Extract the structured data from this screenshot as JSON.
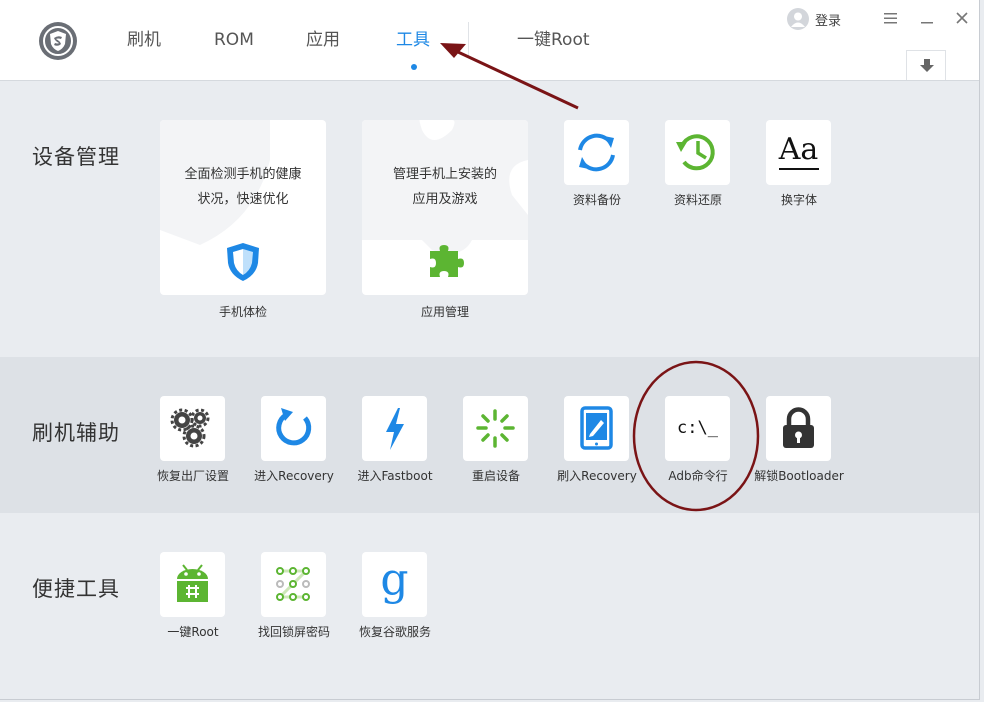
{
  "header": {
    "tabs": [
      {
        "label": "刷机"
      },
      {
        "label": "ROM"
      },
      {
        "label": "应用"
      },
      {
        "label": "工具"
      },
      {
        "label": "一键Root"
      }
    ],
    "active_tab": "工具",
    "login_label": "登录",
    "accent_color": "#1e88e5"
  },
  "device_management": {
    "title": "设备管理",
    "cards": [
      {
        "description_line1": "全面检测手机的健康",
        "description_line2": "状况，快速优化",
        "label": "手机体检",
        "icon": "shield-icon"
      },
      {
        "description_line1": "管理手机上安装的",
        "description_line2": "应用及游戏",
        "label": "应用管理",
        "icon": "puzzle-icon"
      }
    ],
    "tiles": [
      {
        "label": "资料备份",
        "icon": "sync-icon"
      },
      {
        "label": "资料还原",
        "icon": "history-icon"
      },
      {
        "label": "换字体",
        "icon": "font-icon",
        "glyph": "Aa"
      }
    ]
  },
  "flash_assist": {
    "title": "刷机辅助",
    "tiles": [
      {
        "label": "恢复出厂设置",
        "icon": "gears-icon"
      },
      {
        "label": "进入Recovery",
        "icon": "refresh-icon"
      },
      {
        "label": "进入Fastboot",
        "icon": "lightning-icon"
      },
      {
        "label": "重启设备",
        "icon": "loading-icon"
      },
      {
        "label": "刷入Recovery",
        "icon": "tablet-icon"
      },
      {
        "label": "Adb命令行",
        "icon": "terminal-icon",
        "glyph": "c:\\_"
      },
      {
        "label": "解锁Bootloader",
        "icon": "lock-icon"
      }
    ]
  },
  "quick_tools": {
    "title": "便捷工具",
    "tiles": [
      {
        "label": "一键Root",
        "icon": "android-icon"
      },
      {
        "label": "找回锁屏密码",
        "icon": "pattern-lock-icon"
      },
      {
        "label": "恢复谷歌服务",
        "icon": "google-icon",
        "glyph": "g"
      }
    ]
  },
  "colors": {
    "blue": "#1e88e5",
    "green": "#5cb532",
    "annotation": "#7a1416"
  }
}
